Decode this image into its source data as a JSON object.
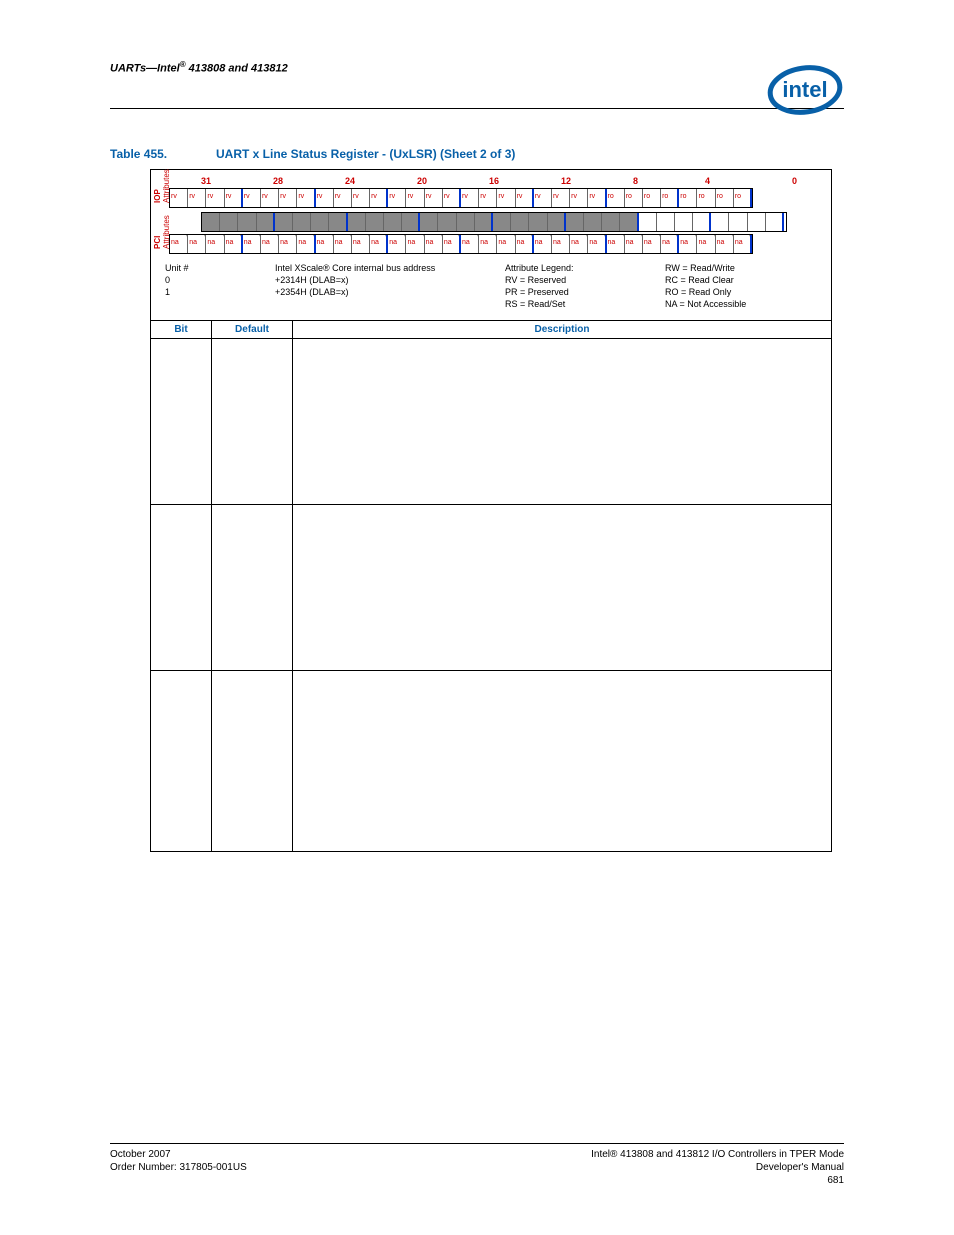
{
  "header": {
    "section": "UARTs—Intel",
    "products": "413808 and 413812"
  },
  "title": {
    "label": "Table 455.",
    "text": "UART x Line Status Register - (UxLSR) (Sheet 2 of 3)"
  },
  "diagram": {
    "bit_numbers": [
      "31",
      "28",
      "24",
      "20",
      "16",
      "12",
      "8",
      "4",
      "0"
    ],
    "iop_label_top": "IOP",
    "iop_label_bottom": "Attributes",
    "pci_label_top": "PCI",
    "pci_label_bottom": "Attributes",
    "iop_attrs": [
      "rv",
      "rv",
      "rv",
      "rv",
      "rv",
      "rv",
      "rv",
      "rv",
      "rv",
      "rv",
      "rv",
      "rv",
      "rv",
      "rv",
      "rv",
      "rv",
      "rv",
      "rv",
      "rv",
      "rv",
      "rv",
      "rv",
      "rv",
      "rv",
      "ro",
      "ro",
      "ro",
      "ro",
      "ro",
      "ro",
      "ro",
      "ro"
    ],
    "pci_attrs": [
      "na",
      "na",
      "na",
      "na",
      "na",
      "na",
      "na",
      "na",
      "na",
      "na",
      "na",
      "na",
      "na",
      "na",
      "na",
      "na",
      "na",
      "na",
      "na",
      "na",
      "na",
      "na",
      "na",
      "na",
      "na",
      "na",
      "na",
      "na",
      "na",
      "na",
      "na",
      "na"
    ],
    "shaded_until_index": 24,
    "unit_label": "Unit #",
    "unit_0": "0",
    "unit_1": "1",
    "addr_label": "Intel XScale® Core internal bus address",
    "addr_0": "+2314H (DLAB=x)",
    "addr_1": "+2354H (DLAB=x)",
    "legend_title": "Attribute Legend:",
    "legend_rv": "RV = Reserved",
    "legend_pr": "PR = Preserved",
    "legend_rs": "RS = Read/Set",
    "legend_rw": "RW = Read/Write",
    "legend_rc": "RC = Read Clear",
    "legend_ro": "RO = Read Only",
    "legend_na": "NA = Not Accessible"
  },
  "columns": {
    "c1": "Bit",
    "c2": "Default",
    "c3": "Description"
  },
  "footer": {
    "left_line1": "October 2007",
    "left_line2": "Order Number: 317805-001US",
    "right_line1": "Intel® 413808 and 413812 I/O Controllers in TPER Mode",
    "right_line2": "Developer's Manual",
    "right_line3": "681"
  }
}
